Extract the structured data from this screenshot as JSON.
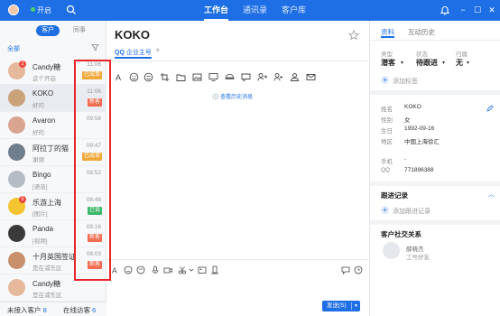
{
  "topbar": {
    "status": "开启",
    "nav": [
      "工作台",
      "通讯录",
      "客户库"
    ],
    "active_nav": "工作台",
    "window_buttons": [
      "−",
      "☐",
      "✕"
    ]
  },
  "left": {
    "segments": [
      "客户",
      "同事"
    ],
    "filter_label": "全部",
    "contacts": [
      {
        "name": "Candy糖",
        "sub": "这个开启",
        "time": "11:06",
        "tag": "已成单",
        "tag_color": "#f0a93b",
        "badge": "2",
        "avatar_color": "#e6b89c"
      },
      {
        "name": "KOKO",
        "sub": "好的",
        "time": "11:06",
        "tag": "新客",
        "tag_color": "#f26c4f",
        "badge": "",
        "avatar_color": "#c9a27a"
      },
      {
        "name": "Avaron",
        "sub": "好的",
        "time": "09:58",
        "tag": "",
        "tag_color": "",
        "badge": "",
        "avatar_color": "#d9a590"
      },
      {
        "name": "阿拉丁的猫",
        "sub": "谢谢",
        "time": "09:47",
        "tag": "已成单",
        "tag_color": "#f0a93b",
        "badge": "",
        "avatar_color": "#6f7d8c"
      },
      {
        "name": "Bingo",
        "sub": "[语音]",
        "time": "08:52",
        "tag": "",
        "tag_color": "",
        "badge": "",
        "avatar_color": "#b5bcc6"
      },
      {
        "name": "乐游上海",
        "sub": "[图片]",
        "time": "08:48",
        "tag": "已谈",
        "tag_color": "#3cb86a",
        "badge": "5",
        "avatar_color": "#f4c431"
      },
      {
        "name": "Panda",
        "sub": "[视频]",
        "time": "08:16",
        "tag": "新客",
        "tag_color": "#f26c4f",
        "badge": "",
        "avatar_color": "#3a3a3a"
      },
      {
        "name": "十月英国签证",
        "sub": "是在浦东区",
        "time": "08:03",
        "tag": "新客",
        "tag_color": "#f26c4f",
        "badge": "",
        "avatar_color": "#c88f6b"
      },
      {
        "name": "Candy糖",
        "sub": "是在浦东区",
        "time": "",
        "tag": "",
        "tag_color": "",
        "badge": "",
        "avatar_color": "#e6b89c"
      }
    ],
    "bottom_tabs": [
      {
        "label": "未接入客户",
        "count": "8"
      },
      {
        "label": "在线访客",
        "count": "6"
      }
    ]
  },
  "chat": {
    "title": "KOKO",
    "tab_prefix": "QQ",
    "tab_label": "企业主号",
    "tab_plus": "+",
    "history_link": "查看历史消息",
    "send_label": "发送(S)",
    "send_caret": "▼"
  },
  "right": {
    "tabs": [
      "资料",
      "互动历史"
    ],
    "type_label": "类型",
    "type_value": "潜客",
    "status_label": "状态",
    "status_value": "待跟进",
    "owner_label": "归属",
    "owner_value": "无",
    "add_tag": "添加标签",
    "info": [
      {
        "label": "姓名",
        "value": "KOKO"
      },
      {
        "label": "性别",
        "value": "女"
      },
      {
        "label": "生日",
        "value": "1992-09-16"
      },
      {
        "label": "地区",
        "value": "中国上海徐汇"
      },
      {
        "label": "手机",
        "value": "-"
      },
      {
        "label": "QQ",
        "value": "771896388"
      }
    ],
    "followup_title": "跟进记录",
    "add_followup": "添加跟进记录",
    "social_title": "客户社交关系",
    "social_name": "薛晓杰",
    "social_sub": "工号好友"
  },
  "colors": {
    "brand": "#1e6fe6",
    "highlight_frame": "#e8252a"
  }
}
